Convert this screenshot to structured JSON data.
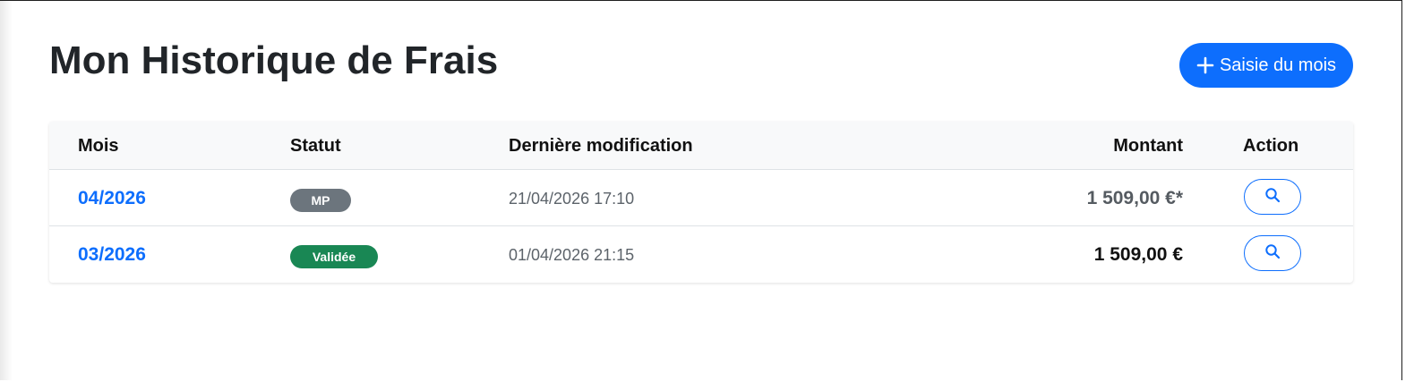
{
  "header": {
    "title": "Mon Historique de Frais",
    "new_button_label": "Saisie du mois",
    "new_button_icon": "plus-icon"
  },
  "colors": {
    "primary": "#0d6efd",
    "badge_secondary": "#6c757d",
    "badge_success": "#198754"
  },
  "table": {
    "columns": [
      "Mois",
      "Statut",
      "Dernière modification",
      "Montant",
      "Action"
    ],
    "rows": [
      {
        "month": "04/2026",
        "status": "MP",
        "last_modified": "21/04/2026 17:10",
        "amount": "1 509,00 €*",
        "action_icon": "search-icon"
      },
      {
        "month": "03/2026",
        "status": "Validée",
        "last_modified": "01/04/2026 21:15",
        "amount": "1 509,00 €",
        "action_icon": "search-icon"
      }
    ]
  }
}
